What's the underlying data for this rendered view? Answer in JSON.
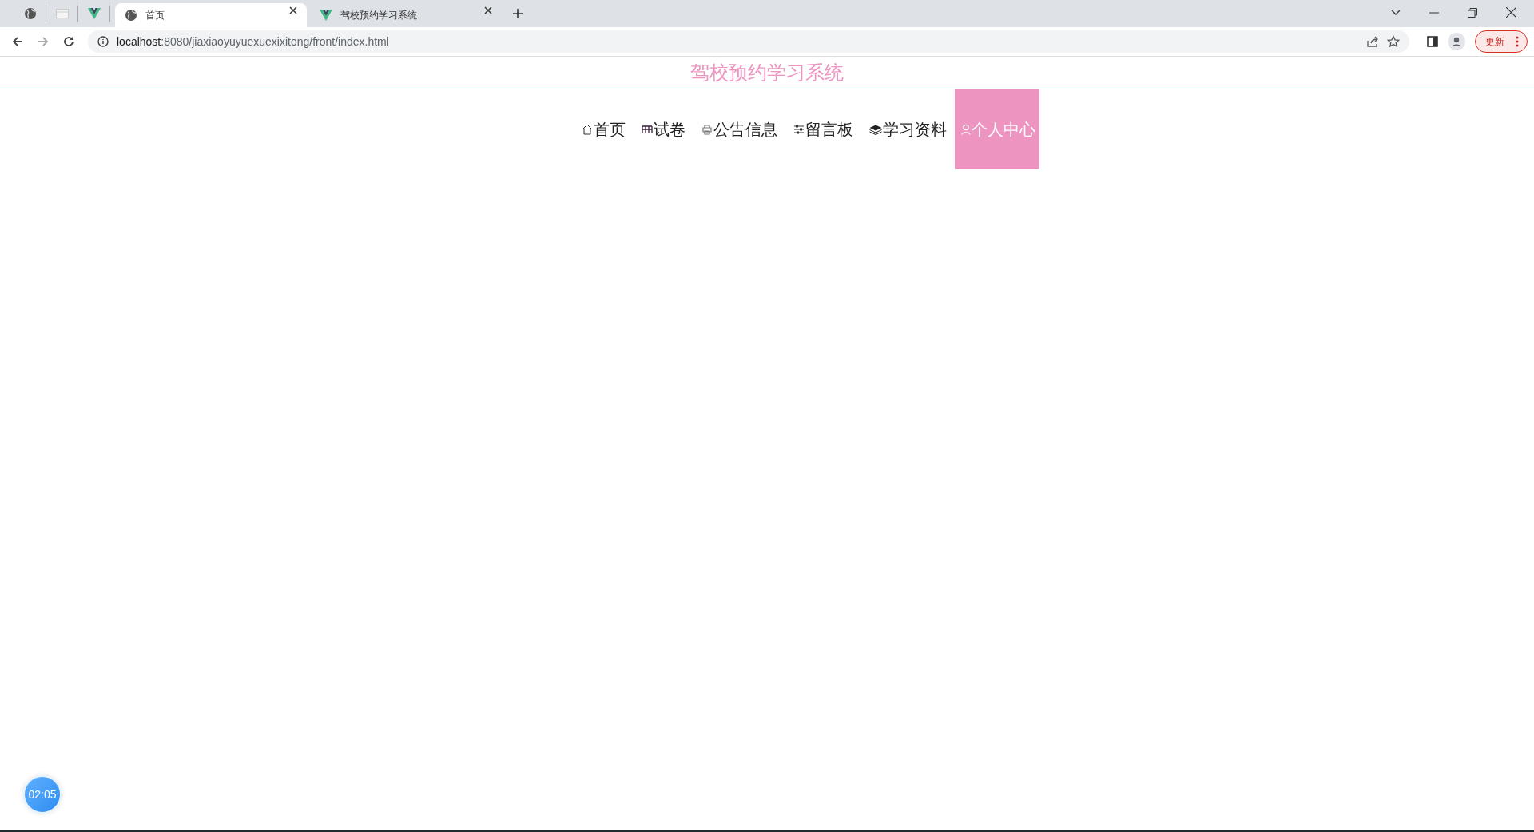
{
  "browser": {
    "tabs": [
      {
        "kind": "pinned",
        "selected": false
      },
      {
        "kind": "pinned",
        "selected": false
      },
      {
        "kind": "pinned",
        "selected": false
      },
      {
        "kind": "normal",
        "title": "首页",
        "selected": true
      },
      {
        "kind": "normal",
        "title": "驾校预约学习系统",
        "selected": false
      }
    ],
    "address": {
      "host": "localhost",
      "rest": ":8080/jiaxiaoyuyuexuexixitong/front/index.html"
    },
    "update_button": "更新"
  },
  "site": {
    "title": "驾校预约学习系统",
    "nav": [
      {
        "label": "首页",
        "selected": false
      },
      {
        "label": "试卷",
        "selected": false
      },
      {
        "label": "公告信息",
        "selected": false
      },
      {
        "label": "留言板",
        "selected": false
      },
      {
        "label": "学习资料",
        "selected": false
      },
      {
        "label": "个人中心",
        "selected": true
      }
    ]
  },
  "timer": "02:05"
}
